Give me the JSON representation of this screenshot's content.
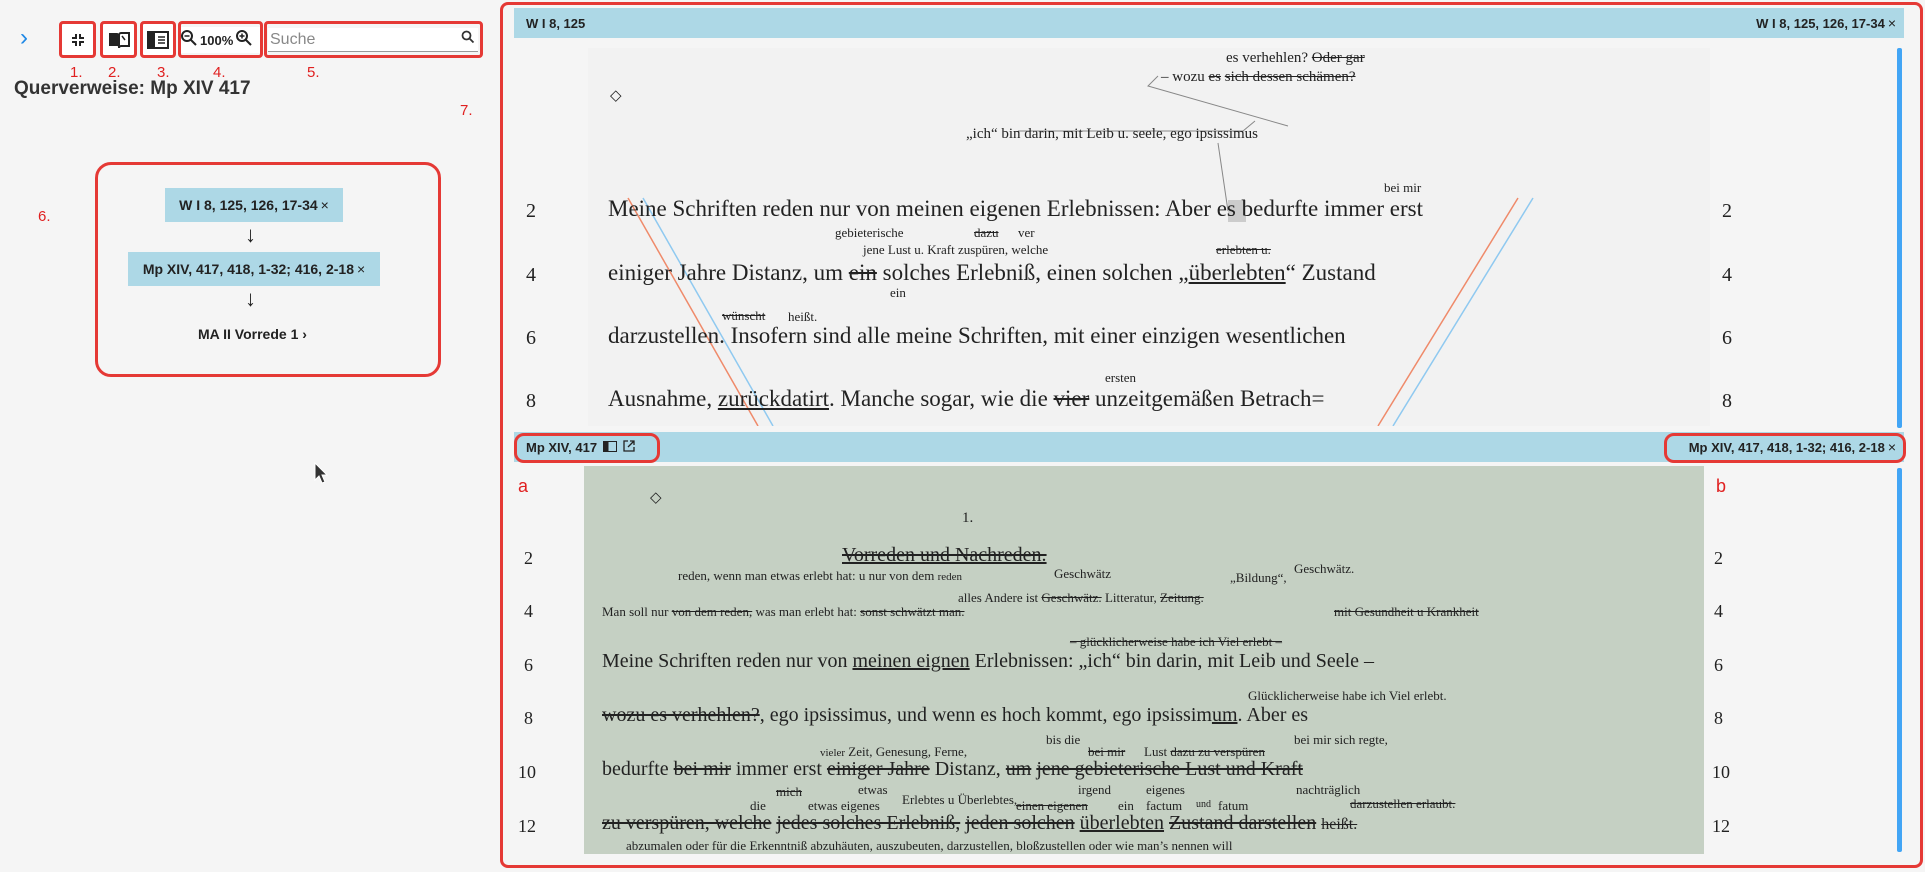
{
  "toolbar": {
    "expand_chevron": "›",
    "zoom_level": "100%",
    "search_placeholder": "Suche",
    "numbers": [
      "1.",
      "2.",
      "3.",
      "4.",
      "5.",
      "6.",
      "7."
    ]
  },
  "left": {
    "title": "Querverweise: Mp XIV 417",
    "nodes": [
      {
        "label": "W I 8, 125, 126, 17-34",
        "close": "×"
      },
      {
        "label": "Mp XIV, 417, 418, 1-32; 416, 2-18",
        "close": "×"
      },
      {
        "label": "MA II Vorrede 1 ›"
      }
    ],
    "arrow": "↓"
  },
  "top_panel": {
    "left_label": "W I 8, 125",
    "right_label": "W I 8, 125, 126, 17-34",
    "close": "×",
    "line_numbers": [
      "2",
      "4",
      "6",
      "8"
    ],
    "diamond": "◇",
    "text": {
      "a1": "es verhehlen?",
      "a2": "Oder gar",
      "b1": "– wozu",
      "b2": "es",
      "b3": "sich dessen schämen?",
      "c": "„ich“ bin darin, mit Leib u. seele, ego ipsissimus",
      "bei_mir": "bei mir",
      "l2a": "Meine Schriften reden nur von meinen eigenen Erlebnissen:",
      "l2b": "A",
      "l2c": "ber es bedurfte",
      "l2d": "immer erst",
      "geb": "gebieterische",
      "dazu": "dazu",
      "ver": "ver",
      "jene": "jene",
      "lust": "Lust u. Kraft",
      "zu": "zu",
      "spueren": "spüren, welche",
      "erlebten": "erlebten u.",
      "l4a": "einiger Jahre Distanz, um",
      "l4b": "ein",
      "l4c": "solches Erlebniß, einen solchen",
      "l4d": "„",
      "l4e": "überlebten",
      "l4f": "“ Zustand",
      "ein2": "ein",
      "wuenscht": "wünscht",
      "heisst": "heißt.",
      "l6": "darzustellen. Insofern sind alle meine Schriften, mit einer einzigen wesentlichen",
      "ersten": "ersten",
      "l8a": "Ausnahme,",
      "l8b": "zurückdatirt",
      "l8c": ". Manche sogar, wie die",
      "l8d": "vier",
      "l8e": "unzeitgemäßen Betrach="
    }
  },
  "bottom_panel": {
    "left_label": "Mp XIV, 417",
    "right_label": "Mp XIV, 417, 418, 1-32; 416, 2-18",
    "close": "×",
    "mark_a": "a",
    "mark_b": "b",
    "line_numbers": [
      "2",
      "4",
      "6",
      "8",
      "10",
      "12"
    ],
    "diamond": "◇",
    "text": {
      "one": "1.",
      "heading": "Vorreden und Nachreden.",
      "r1": "reden, wenn man etwas erlebt hat: u nur von dem",
      "r1b": "reden",
      "gesch": "Geschwätz",
      "bildung": "„Bildung“,",
      "gesch2": "Geschwätz.",
      "alles": "alles Andere ist",
      "gesch3": "Geschwätz.",
      "litt": "Litteratur,",
      "zeitung": "Zeitung.",
      "l4a": "Man soll nur",
      "l4b": "von dem reden,",
      "l4c": "was man erlebt hat:",
      "l4d": "sonst schwätzt man.",
      "l4e": "mit Gesundheit u Krankheit",
      "glueck": "– glücklicherweise habe ich Viel erlebt –",
      "l6a": "Meine Schriften reden nur von",
      "l6b": "meinen eignen",
      "l6c": "Erlebnissen:",
      "l6d": "„ich“ bin darin, mit Leib und Seele –",
      "glueck2": "Glücklicherweise habe ich Viel erlebt.",
      "l8a": "wozu es verhehlen?",
      "l8b": ", ego ipsissimus, und wenn es hoch kommt, ego ipsissim",
      "l8c": "um",
      "l8d": ". Aber es",
      "bisdie": "bis die",
      "vieler": "vieler",
      "zeit": "Zeit, Genesung, Ferne,",
      "beimir": "bei mir",
      "lust": "Lust",
      "dazuzu": "dazu zu verspüren",
      "beimirsich": "bei mir sich regte,",
      "l10a": "bedurfte",
      "l10b": "bei mir",
      "l10c": "immer erst",
      "l10d": "einiger Jahre",
      "l10e": "Distanz,",
      "l10f": "um",
      "l10g": "jene gebieterische Lust und Kraft",
      "etwas": "etwas",
      "mich": "mich",
      "ueberlebtes": "Erlebtes u Überlebtes,",
      "irgend": "irgend",
      "eigenes": "eigenes",
      "nachtr": "nachträglich",
      "die": "die",
      "etwaseig": "etwas eigenes",
      "einen": "einen eigenen",
      "ein": "ein",
      "factum": "factum",
      "und": "und",
      "fatum": "fatum",
      "darzerl": "darzustellen erlaubt.",
      "l12a": "zu verspüren, welche",
      "l12b": "jedes solches Erlebniß,",
      "l12c": "jeden solchen",
      "l12d": "überlebten",
      "l12e": "Zustand darstellen",
      "l12f": "heißt.",
      "last": "abzumalen oder für die Erkenntniß abzuhäuten, auszubeuten, darzustellen, bloßzustellen oder wie man’s nennen will"
    }
  }
}
